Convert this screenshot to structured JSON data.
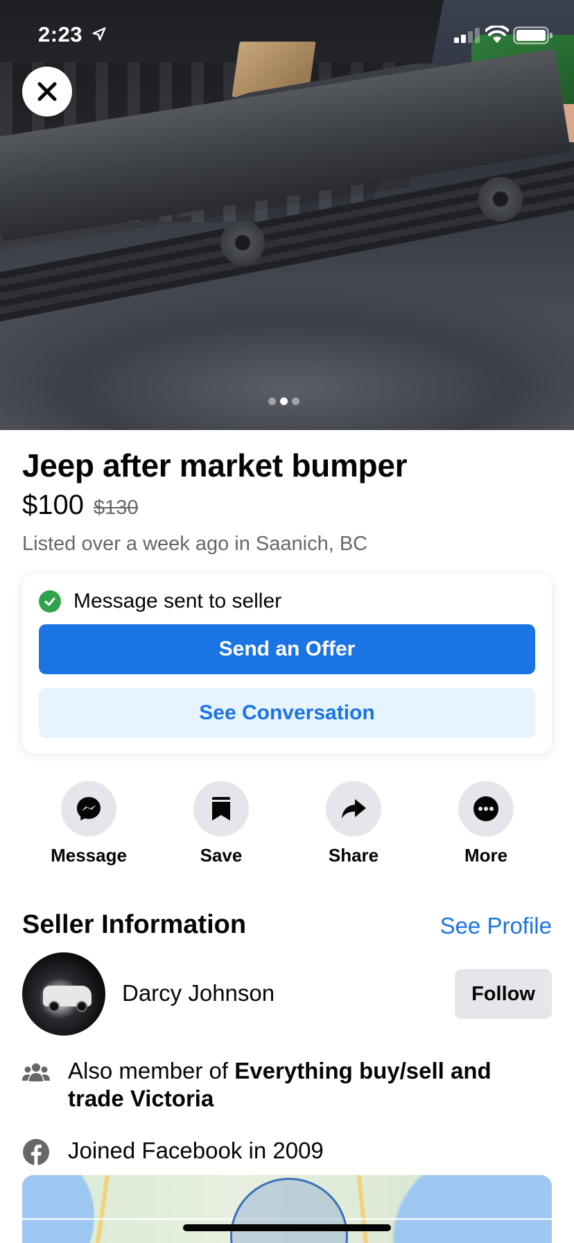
{
  "status_bar": {
    "time": "2:23"
  },
  "photo": {
    "pages": 3,
    "current_page": 2
  },
  "listing": {
    "title": "Jeep after market bumper",
    "price": "$100",
    "original_price": "$130",
    "listed": "Listed over a week ago in Saanich, BC"
  },
  "message_card": {
    "status_text": "Message sent to seller",
    "primary_button": "Send an Offer",
    "secondary_button": "See Conversation"
  },
  "actions": [
    {
      "label": "Message",
      "icon": "messenger-icon"
    },
    {
      "label": "Save",
      "icon": "bookmark-icon"
    },
    {
      "label": "Share",
      "icon": "share-icon"
    },
    {
      "label": "More",
      "icon": "more-icon"
    }
  ],
  "seller": {
    "section_title": "Seller Information",
    "see_profile": "See Profile",
    "name": "Darcy Johnson",
    "follow": "Follow",
    "group_prefix": "Also member of ",
    "group_name": "Everything buy/sell and trade Victoria",
    "joined": "Joined Facebook in 2009"
  },
  "colors": {
    "accent": "#1b74e4",
    "accent_light": "#e7f3ff",
    "success": "#31a24c",
    "secondary_text": "#65676b",
    "button_gray": "#e4e6eb"
  }
}
